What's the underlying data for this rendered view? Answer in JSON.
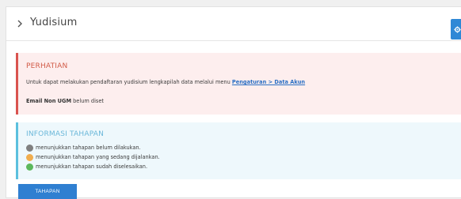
{
  "header": {
    "title": "Yudisium",
    "accent": "#2f88d6"
  },
  "alert_warning": {
    "title": "PERHATIAN",
    "text_prefix": "Untuk dapat melakukan pendaftaran yudisium lengkapilah data melalui menu",
    "link_label": "Pengaturan > Data Akun",
    "status_bold": "Email Non UGM",
    "status_rest": "belum diset",
    "color": "#d9534f"
  },
  "alert_info": {
    "title": "INFORMASI TAHAPAN",
    "color": "#5bc0de",
    "legend": [
      {
        "label": "menunjukkan tahapan belum dilakukan.",
        "color": "#808080"
      },
      {
        "label": "menunjukkan tahapan yang sedang dijalankan.",
        "color": "#f0ad4e"
      },
      {
        "label": "menunjukkan tahapan sudah diselesaikan.",
        "color": "#5cb85c"
      }
    ]
  },
  "footer": {
    "button_label": "TAHAPAN"
  }
}
